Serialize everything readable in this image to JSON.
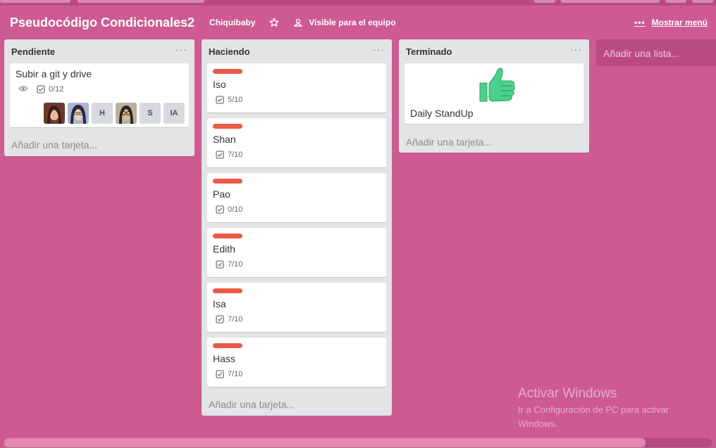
{
  "board": {
    "title": "Pseudocódigo Condicionales2",
    "team": "Chiquibaby",
    "visibility": "Visible para el equipo",
    "show_menu": "Mostrar menú"
  },
  "lists": [
    {
      "title": "Pendiente",
      "add_card": "Añadir una tarjeta...",
      "cards": [
        {
          "title": "Subir a git y drive",
          "checklist": "0/12",
          "watching": true,
          "members": [
            {
              "type": "photo"
            },
            {
              "type": "photo"
            },
            {
              "type": "initials",
              "text": "H"
            },
            {
              "type": "photo"
            },
            {
              "type": "initials",
              "text": "S"
            },
            {
              "type": "initials",
              "text": "IA"
            }
          ]
        }
      ]
    },
    {
      "title": "Haciendo",
      "add_card": "Añadir una tarjeta...",
      "label_color": "#eb5a46",
      "cards": [
        {
          "title": "Iso",
          "checklist": "5/10"
        },
        {
          "title": "Shan",
          "checklist": "7/10"
        },
        {
          "title": "Pao",
          "checklist": "0/10"
        },
        {
          "title": "Edith",
          "checklist": "7/10"
        },
        {
          "title": "Isa",
          "checklist": "7/10"
        },
        {
          "title": "Hass",
          "checklist": "7/10"
        }
      ]
    },
    {
      "title": "Terminado",
      "add_card": "Añadir una tarjeta...",
      "cards": [
        {
          "title": "Daily StandUp",
          "cover": "thumbs-up-sticker"
        }
      ]
    }
  ],
  "add_list": "Añadir una lista...",
  "watermark": {
    "title": "Activar Windows",
    "subtitle": "Ir a Configuración de PC para activar Windows."
  },
  "colors": {
    "background": "#cd5a91",
    "list": "#e2e4e6",
    "label_red": "#eb5a46",
    "sticker_green": "#4cd08d"
  }
}
